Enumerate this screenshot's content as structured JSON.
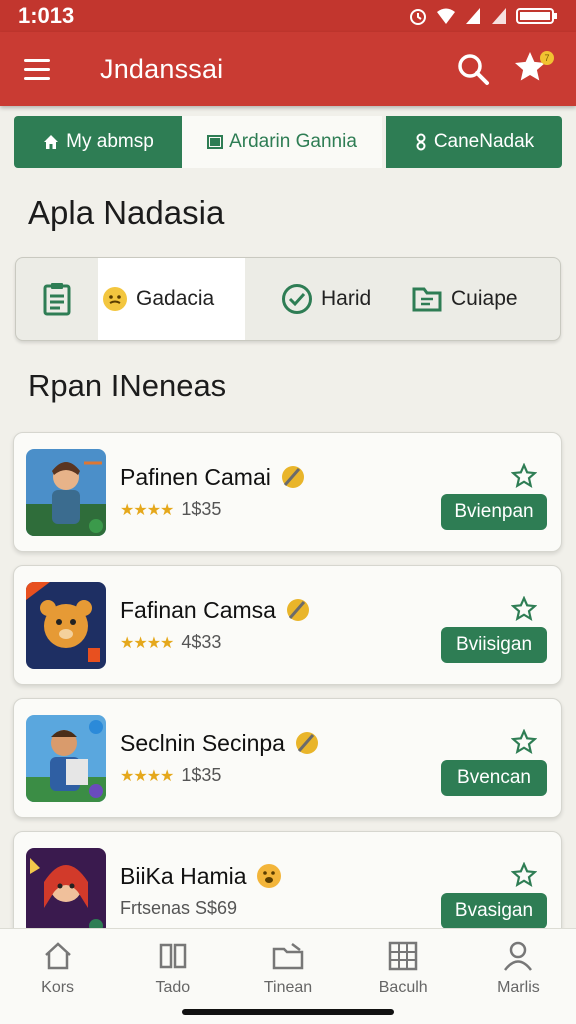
{
  "status_bar": {
    "time": "1:013"
  },
  "app_bar": {
    "title": "Jndanssai",
    "badge": "7"
  },
  "tabs": [
    {
      "label": "My abmsp"
    },
    {
      "label": "Ardarin Gannia"
    },
    {
      "label": "CaneNadak"
    }
  ],
  "section_title": "Apla Nadasia",
  "filters": [
    {
      "label": "Gadacia"
    },
    {
      "label": "Harid"
    },
    {
      "label": "Cuiape"
    }
  ],
  "list_title": "Rpan INeneas",
  "games": [
    {
      "title": "Pafinen Camai",
      "rating_stars": "★★★★",
      "meta": "1$35",
      "action": "Bvienpan"
    },
    {
      "title": "Fafinan Camsa",
      "rating_stars": "★★★★",
      "meta": "4$33",
      "action": "Bviisigan"
    },
    {
      "title": "Seclnin Secinpa",
      "rating_stars": "★★★★",
      "meta": "1$35",
      "action": "Bvencan"
    },
    {
      "title": "BiiKa Hamia",
      "rating_stars": "",
      "meta": "Frtsenas S$69",
      "action": "Bvasigan"
    }
  ],
  "bottom_nav": [
    {
      "label": "Kors"
    },
    {
      "label": "Tado"
    },
    {
      "label": "Tinean"
    },
    {
      "label": "Baculh"
    },
    {
      "label": "Marlis"
    }
  ],
  "colors": {
    "primary_red": "#c93b33",
    "accent_green": "#2e7d54",
    "star_gold": "#e5a81c"
  }
}
